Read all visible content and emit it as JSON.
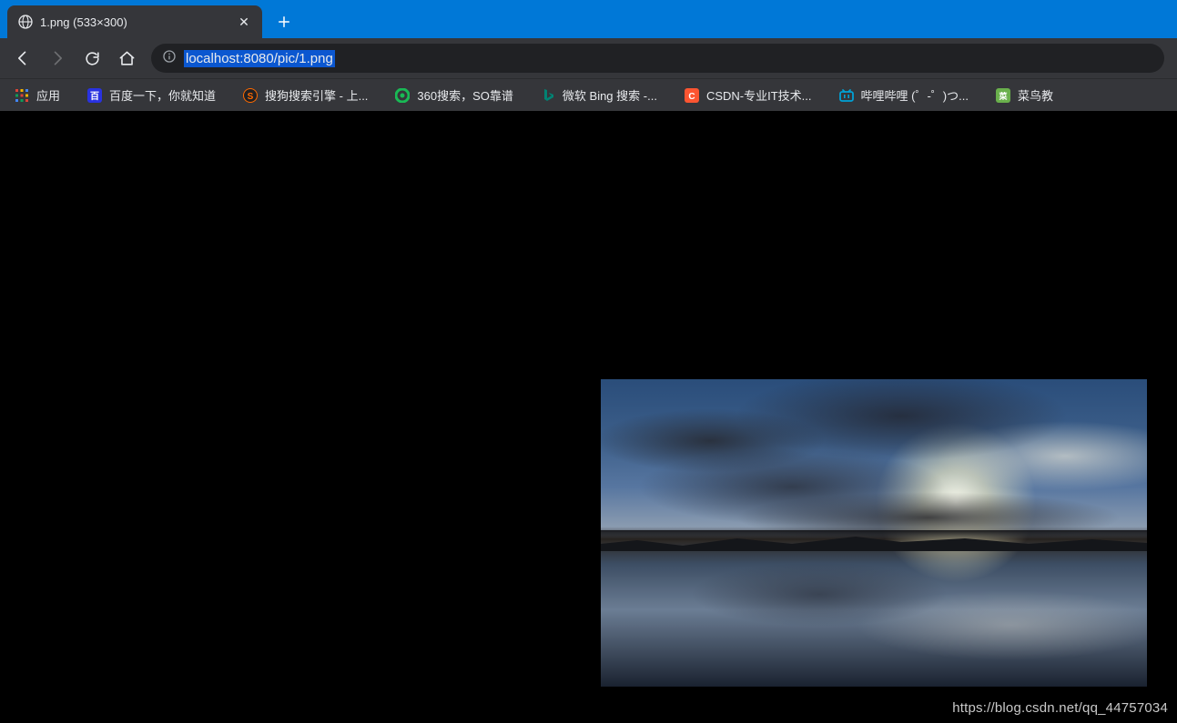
{
  "tab": {
    "title": "1.png (533×300)"
  },
  "toolbar": {
    "url": "localhost:8080/pic/1.png"
  },
  "bookmarks": {
    "apps_label": "应用",
    "items": [
      {
        "label": "百度一下，你就知道",
        "color": "#2932e1"
      },
      {
        "label": "搜狗搜索引擎 - 上...",
        "color": "#ff6a00"
      },
      {
        "label": "360搜索，SO靠谱",
        "color": "#19b955"
      },
      {
        "label": "微软 Bing 搜索 -...",
        "color": "#008373"
      },
      {
        "label": "CSDN-专业IT技术...",
        "color": "#fc5531"
      },
      {
        "label": "哔哩哔哩 (゜-゜)つ...",
        "color": "#00a1d6"
      },
      {
        "label": "菜鸟教",
        "color": "#6ab04c"
      }
    ]
  },
  "content": {
    "image_alt": "sunset over lake with cloud reflections"
  },
  "watermark": "https://blog.csdn.net/qq_44757034"
}
